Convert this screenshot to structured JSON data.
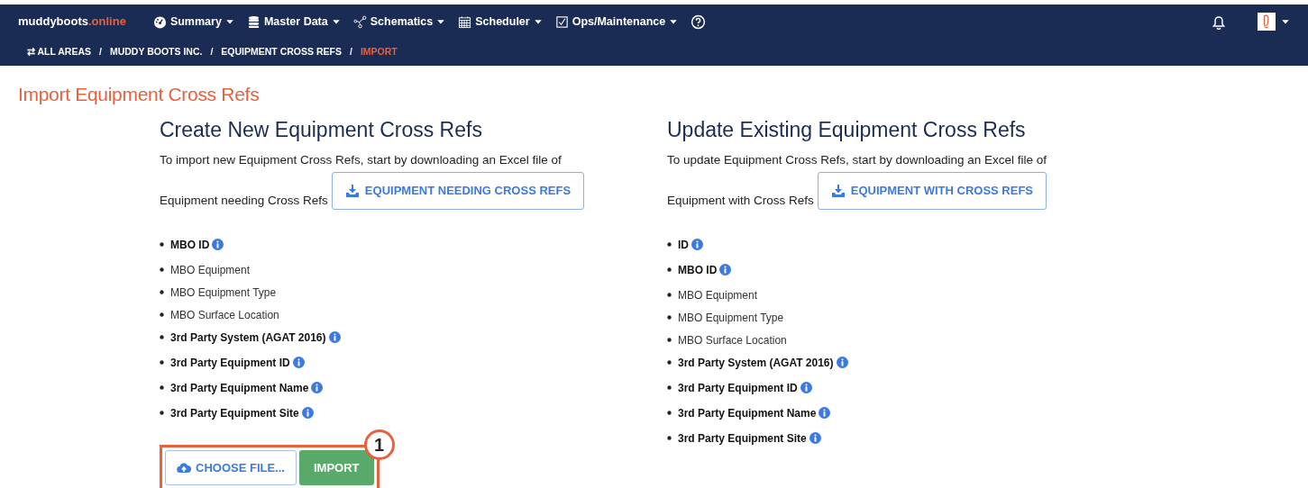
{
  "navbar": {
    "brand": {
      "name": "muddyboots",
      "suffix": ".online"
    },
    "menus": [
      {
        "label": "Summary"
      },
      {
        "label": "Master Data"
      },
      {
        "label": "Schematics"
      },
      {
        "label": "Scheduler"
      },
      {
        "label": "Ops/Maintenance"
      }
    ]
  },
  "breadcrumb": [
    {
      "icon": "⇄",
      "label": "ALL AREAS",
      "current": false
    },
    {
      "label": "MUDDY BOOTS INC.",
      "current": false
    },
    {
      "label": "EQUIPMENT CROSS REFS",
      "current": false
    },
    {
      "label": "IMPORT",
      "current": true
    }
  ],
  "breadcrumb_separator": "/",
  "page_title": "Import Equipment Cross Refs",
  "sections": [
    {
      "heading": "Create New Equipment Cross Refs",
      "intro_line_1": "To import new Equipment Cross Refs, start by downloading an Excel file of",
      "intro_line_2": "Equipment needing Cross Refs",
      "download_button": "EQUIPMENT NEEDING CROSS REFS",
      "fields": [
        {
          "label": "MBO ID",
          "bold": true,
          "info": true
        },
        {
          "label": "MBO Equipment",
          "bold": false,
          "info": false
        },
        {
          "label": "MBO Equipment Type",
          "bold": false,
          "info": false
        },
        {
          "label": "MBO Surface Location",
          "bold": false,
          "info": false
        },
        {
          "label": "3rd Party System (AGAT 2016)",
          "bold": true,
          "info": true
        },
        {
          "label": "3rd Party Equipment ID",
          "bold": true,
          "info": true
        },
        {
          "label": "3rd Party Equipment Name",
          "bold": true,
          "info": true
        },
        {
          "label": "3rd Party Equipment Site",
          "bold": true,
          "info": true
        }
      ],
      "choose_button": "CHOOSE FILE...",
      "import_button": "IMPORT",
      "callout": "1"
    },
    {
      "heading": "Update Existing Equipment Cross Refs",
      "intro_line_1": "To update Equipment Cross Refs, start by downloading an Excel file of",
      "intro_line_2": "Equipment with Cross Refs",
      "download_button": "EQUIPMENT WITH CROSS REFS",
      "fields": [
        {
          "label": "ID",
          "bold": true,
          "info": true
        },
        {
          "label": "MBO ID",
          "bold": true,
          "info": true
        },
        {
          "label": "MBO Equipment",
          "bold": false,
          "info": false
        },
        {
          "label": "MBO Equipment Type",
          "bold": false,
          "info": false
        },
        {
          "label": "MBO Surface Location",
          "bold": false,
          "info": false
        },
        {
          "label": "3rd Party System (AGAT 2016)",
          "bold": true,
          "info": true
        },
        {
          "label": "3rd Party Equipment ID",
          "bold": true,
          "info": true
        },
        {
          "label": "3rd Party Equipment Name",
          "bold": true,
          "info": true
        },
        {
          "label": "3rd Party Equipment Site",
          "bold": true,
          "info": true
        }
      ]
    }
  ]
}
